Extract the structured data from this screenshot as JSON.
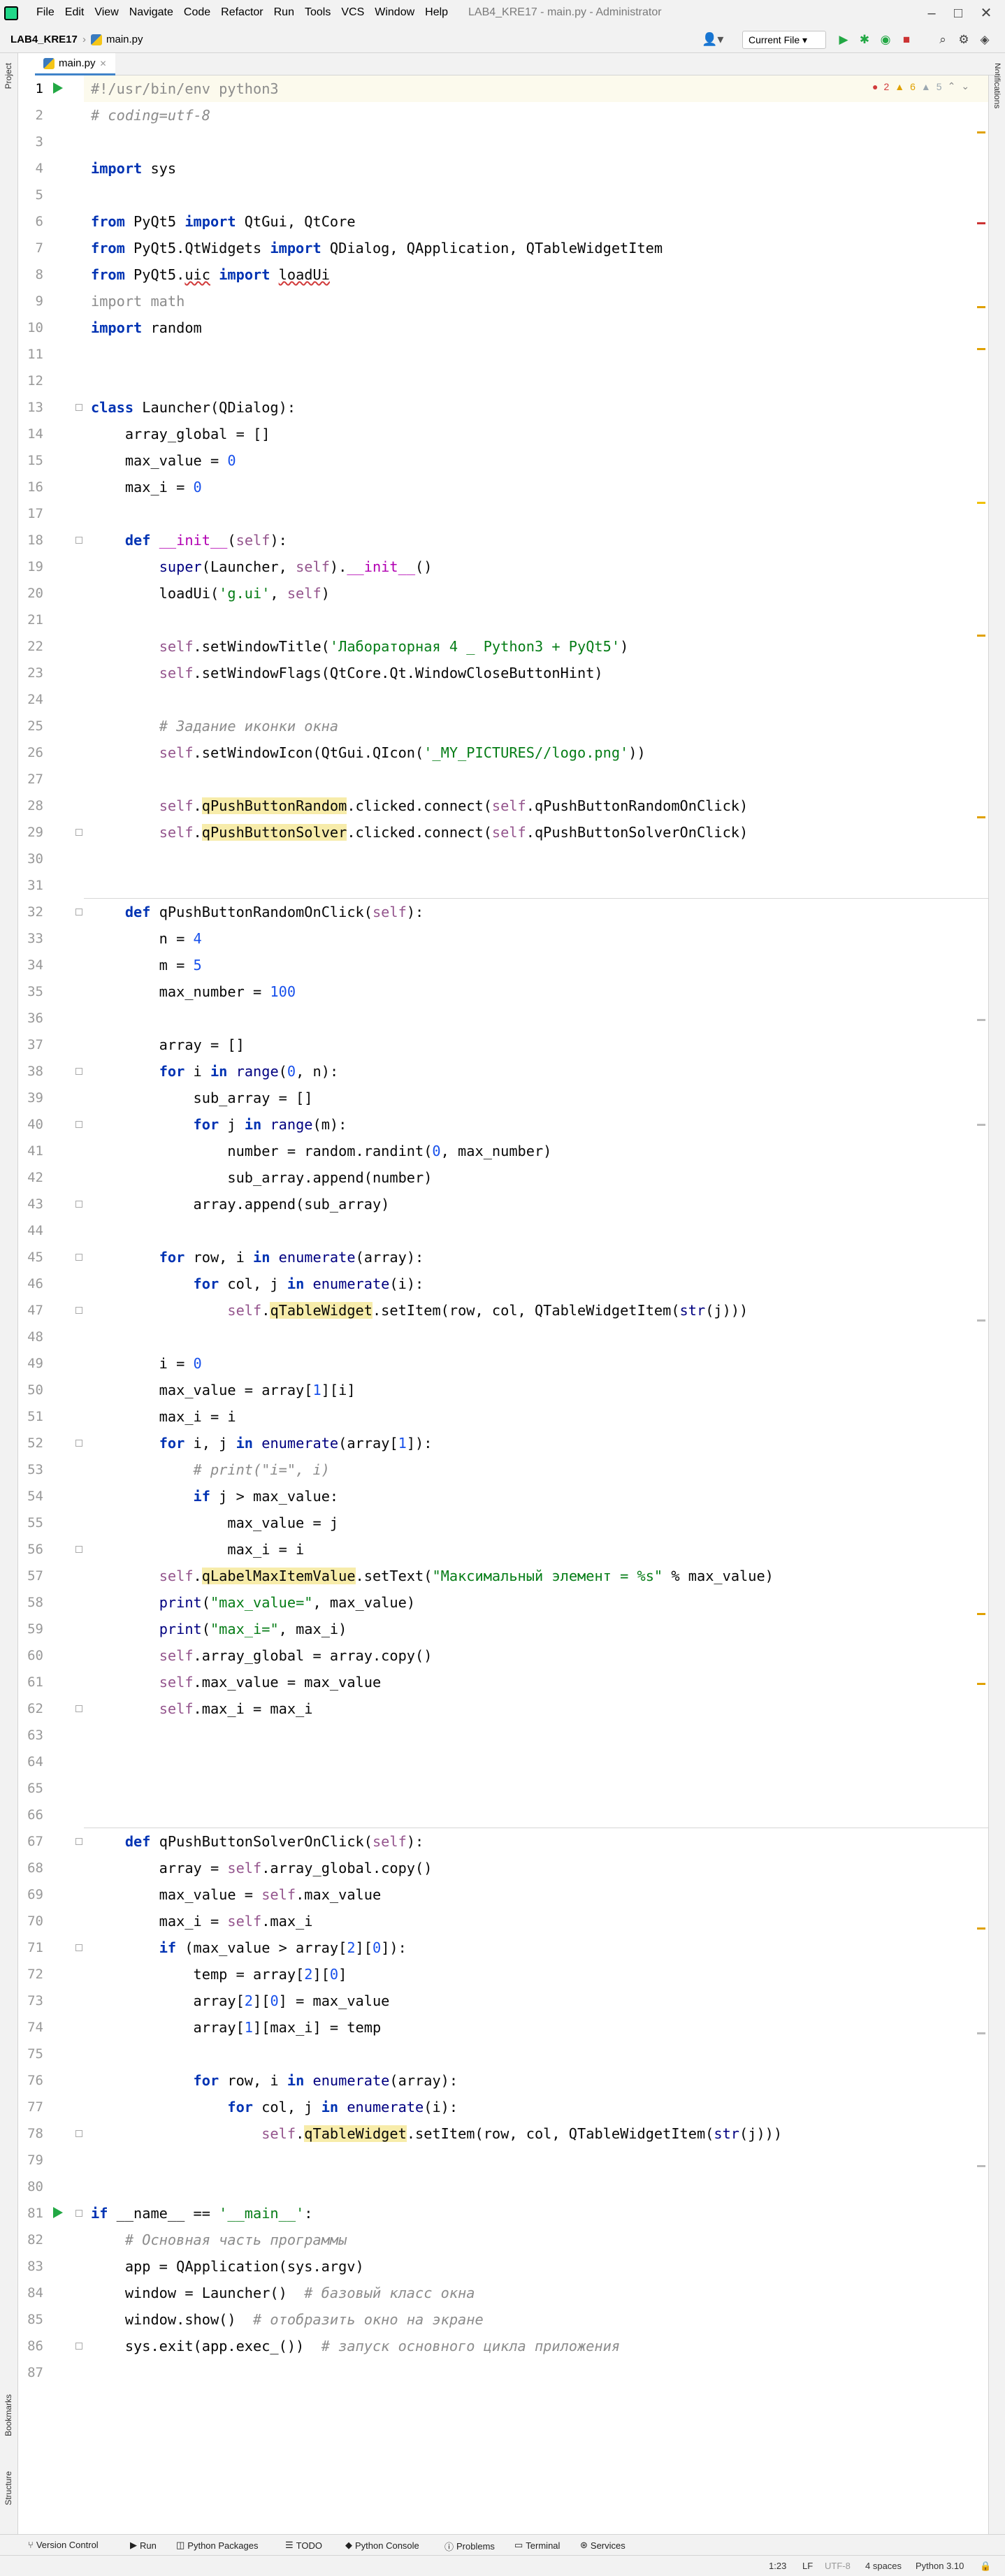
{
  "menubar": {
    "items": [
      "File",
      "Edit",
      "View",
      "Navigate",
      "Code",
      "Refactor",
      "Run",
      "Tools",
      "VCS",
      "Window",
      "Help"
    ],
    "window_title": "LAB4_KRE17 - main.py - Administrator"
  },
  "navbar": {
    "project": "LAB4_KRE17",
    "file": "main.py",
    "run_config": "Current File"
  },
  "tab": {
    "label": "main.py"
  },
  "inspections": {
    "errors": "2",
    "warnings": "6",
    "weak": "5"
  },
  "side_tabs": {
    "project": "Project",
    "bookmarks": "Bookmarks",
    "structure": "Structure",
    "notifications": "Notifications"
  },
  "code_lines": [
    {
      "n": "1",
      "html": "<span class='cm' style='font-style:normal;color:#8c8c8c'>#!/usr/bin/env python3</span>"
    },
    {
      "n": "2",
      "html": "<span class='cm'># coding=utf-8</span>"
    },
    {
      "n": "3",
      "html": ""
    },
    {
      "n": "4",
      "html": "<span class='kw'>import</span> sys"
    },
    {
      "n": "5",
      "html": ""
    },
    {
      "n": "6",
      "html": "<span class='kw'>from</span> PyQt5 <span class='kw'>import</span> QtGui, QtCore"
    },
    {
      "n": "7",
      "html": "<span class='kw'>from</span> PyQt5.QtWidgets <span class='kw'>import</span> QDialog, QApplication, QTableWidgetItem"
    },
    {
      "n": "8",
      "html": "<span class='kw'>from</span> PyQt5.<span class='ul'>uic</span> <span class='kw'>import</span> <span class='ul'>loadUi</span>"
    },
    {
      "n": "9",
      "html": "<span class='dim'>import math</span>"
    },
    {
      "n": "10",
      "html": "<span class='kw'>import</span> random"
    },
    {
      "n": "11",
      "html": ""
    },
    {
      "n": "12",
      "html": ""
    },
    {
      "n": "13",
      "html": "<span class='kw'>class</span> Launcher(QDialog):"
    },
    {
      "n": "14",
      "html": "    array_global = []"
    },
    {
      "n": "15",
      "html": "    max_value = <span class='nm'>0</span>"
    },
    {
      "n": "16",
      "html": "    max_i = <span class='nm'>0</span>"
    },
    {
      "n": "17",
      "html": ""
    },
    {
      "n": "18",
      "html": "    <span class='kw'>def</span> <span class='mg'>__init__</span>(<span class='sl'>self</span>):"
    },
    {
      "n": "19",
      "html": "        <span class='bi'>super</span>(Launcher, <span class='sl'>self</span>).<span class='mg'>__init__</span>()"
    },
    {
      "n": "20",
      "html": "        loadUi(<span class='str'>'g.ui'</span>, <span class='sl'>self</span>)"
    },
    {
      "n": "21",
      "html": ""
    },
    {
      "n": "22",
      "html": "        <span class='sl'>self</span>.setWindowTitle(<span class='str'>'Лабораторная 4 _ Python3 + PyQt5'</span>)"
    },
    {
      "n": "23",
      "html": "        <span class='sl'>self</span>.setWindowFlags(QtCore.Qt.WindowCloseButtonHint)"
    },
    {
      "n": "24",
      "html": ""
    },
    {
      "n": "25",
      "html": "        <span class='cm'># Задание иконки окна</span>"
    },
    {
      "n": "26",
      "html": "        <span class='sl'>self</span>.setWindowIcon(QtGui.QIcon(<span class='str'>'_MY_PICTURES//logo.png'</span>))"
    },
    {
      "n": "27",
      "html": ""
    },
    {
      "n": "28",
      "html": "        <span class='sl'>self</span>.<span class='hl'>qPushButtonRandom</span>.clicked.connect(<span class='sl'>self</span>.qPushButtonRandomOnClick)"
    },
    {
      "n": "29",
      "html": "        <span class='sl'>self</span>.<span class='hl'>qPushButtonSolver</span>.clicked.connect(<span class='sl'>self</span>.qPushButtonSolverOnClick)"
    },
    {
      "n": "30",
      "html": ""
    },
    {
      "n": "31",
      "html": ""
    },
    {
      "n": "32",
      "html": "    <span class='kw'>def</span> qPushButtonRandomOnClick(<span class='sl'>self</span>):"
    },
    {
      "n": "33",
      "html": "        n = <span class='nm'>4</span>"
    },
    {
      "n": "34",
      "html": "        m = <span class='nm'>5</span>"
    },
    {
      "n": "35",
      "html": "        max_number = <span class='nm'>100</span>"
    },
    {
      "n": "36",
      "html": ""
    },
    {
      "n": "37",
      "html": "        array = []"
    },
    {
      "n": "38",
      "html": "        <span class='kw'>for</span> i <span class='kw'>in</span> <span class='bi'>range</span>(<span class='nm'>0</span>, n):"
    },
    {
      "n": "39",
      "html": "            sub_array = []"
    },
    {
      "n": "40",
      "html": "            <span class='kw'>for</span> j <span class='kw'>in</span> <span class='bi'>range</span>(m):"
    },
    {
      "n": "41",
      "html": "                number = random.randint(<span class='nm'>0</span>, max_number)"
    },
    {
      "n": "42",
      "html": "                sub_array.append(number)"
    },
    {
      "n": "43",
      "html": "            array.append(sub_array)"
    },
    {
      "n": "44",
      "html": ""
    },
    {
      "n": "45",
      "html": "        <span class='kw'>for</span> row, i <span class='kw'>in</span> <span class='bi'>enumerate</span>(array):"
    },
    {
      "n": "46",
      "html": "            <span class='kw'>for</span> col, j <span class='kw'>in</span> <span class='bi'>enumerate</span>(i):"
    },
    {
      "n": "47",
      "html": "                <span class='sl'>self</span>.<span class='hl'>qTableWidget</span>.setItem(row, col, QTableWidgetItem(<span class='bi'>str</span>(j)))"
    },
    {
      "n": "48",
      "html": ""
    },
    {
      "n": "49",
      "html": "        i = <span class='nm'>0</span>"
    },
    {
      "n": "50",
      "html": "        max_value = array[<span class='nm'>1</span>][i]"
    },
    {
      "n": "51",
      "html": "        max_i = i"
    },
    {
      "n": "52",
      "html": "        <span class='kw'>for</span> i, j <span class='kw'>in</span> <span class='bi'>enumerate</span>(array[<span class='nm'>1</span>]):"
    },
    {
      "n": "53",
      "html": "            <span class='cm'># print(\"i=\", i)</span>"
    },
    {
      "n": "54",
      "html": "            <span class='kw'>if</span> j &gt; max_value:"
    },
    {
      "n": "55",
      "html": "                max_value = j"
    },
    {
      "n": "56",
      "html": "                max_i = i"
    },
    {
      "n": "57",
      "html": "        <span class='sl'>self</span>.<span class='hl'>qLabelMaxItemValue</span>.setText(<span class='str'>\"Максимальный элемент = %s\"</span> % max_value)"
    },
    {
      "n": "58",
      "html": "        <span class='bi'>print</span>(<span class='str'>\"max_value=\"</span>, max_value)"
    },
    {
      "n": "59",
      "html": "        <span class='bi'>print</span>(<span class='str'>\"max_i=\"</span>, max_i)"
    },
    {
      "n": "60",
      "html": "        <span class='sl'>self</span>.array_global = array.copy()"
    },
    {
      "n": "61",
      "html": "        <span class='sl'>self</span>.max_value = max_value"
    },
    {
      "n": "62",
      "html": "        <span class='sl'>self</span>.max_i = max_i"
    },
    {
      "n": "63",
      "html": ""
    },
    {
      "n": "64",
      "html": ""
    },
    {
      "n": "65",
      "html": ""
    },
    {
      "n": "66",
      "html": ""
    },
    {
      "n": "67",
      "html": "    <span class='kw'>def</span> qPushButtonSolverOnClick(<span class='sl'>self</span>):"
    },
    {
      "n": "68",
      "html": "        array = <span class='sl'>self</span>.array_global.copy()"
    },
    {
      "n": "69",
      "html": "        max_value = <span class='sl'>self</span>.max_value"
    },
    {
      "n": "70",
      "html": "        max_i = <span class='sl'>self</span>.max_i"
    },
    {
      "n": "71",
      "html": "        <span class='kw'>if</span> (max_value &gt; array[<span class='nm'>2</span>][<span class='nm'>0</span>]):"
    },
    {
      "n": "72",
      "html": "            temp = array[<span class='nm'>2</span>][<span class='nm'>0</span>]"
    },
    {
      "n": "73",
      "html": "            array[<span class='nm'>2</span>][<span class='nm'>0</span>] = max_value"
    },
    {
      "n": "74",
      "html": "            array[<span class='nm'>1</span>][max_i] = temp"
    },
    {
      "n": "75",
      "html": ""
    },
    {
      "n": "76",
      "html": "            <span class='kw'>for</span> row, i <span class='kw'>in</span> <span class='bi'>enumerate</span>(array):"
    },
    {
      "n": "77",
      "html": "                <span class='kw'>for</span> col, j <span class='kw'>in</span> <span class='bi'>enumerate</span>(i):"
    },
    {
      "n": "78",
      "html": "                    <span class='sl'>self</span>.<span class='hl'>qTableWidget</span>.setItem(row, col, QTableWidgetItem(<span class='bi'>str</span>(j)))"
    },
    {
      "n": "79",
      "html": ""
    },
    {
      "n": "80",
      "html": ""
    },
    {
      "n": "81",
      "html": "<span class='kw'>if</span> __name__ == <span class='str'>'__main__'</span>:"
    },
    {
      "n": "82",
      "html": "    <span class='cm'># Основная часть программы</span>"
    },
    {
      "n": "83",
      "html": "    app = QApplication(sys.argv)"
    },
    {
      "n": "84",
      "html": "    window = Launcher()  <span class='cm'># базовый класс окна</span>"
    },
    {
      "n": "85",
      "html": "    window.show()  <span class='cm'># отобразить окно на экране</span>"
    },
    {
      "n": "86",
      "html": "    sys.exit(app.exec_())  <span class='cm'># запуск основного цикла приложения</span>"
    },
    {
      "n": "87",
      "html": ""
    }
  ],
  "tool_windows": [
    "Version Control",
    "Run",
    "Python Packages",
    "TODO",
    "Python Console",
    "Problems",
    "Terminal",
    "Services"
  ],
  "status": {
    "position": "1:23",
    "line_sep": "LF",
    "encoding": "UTF-8",
    "indent": "4 spaces",
    "interpreter": "Python 3.10"
  }
}
